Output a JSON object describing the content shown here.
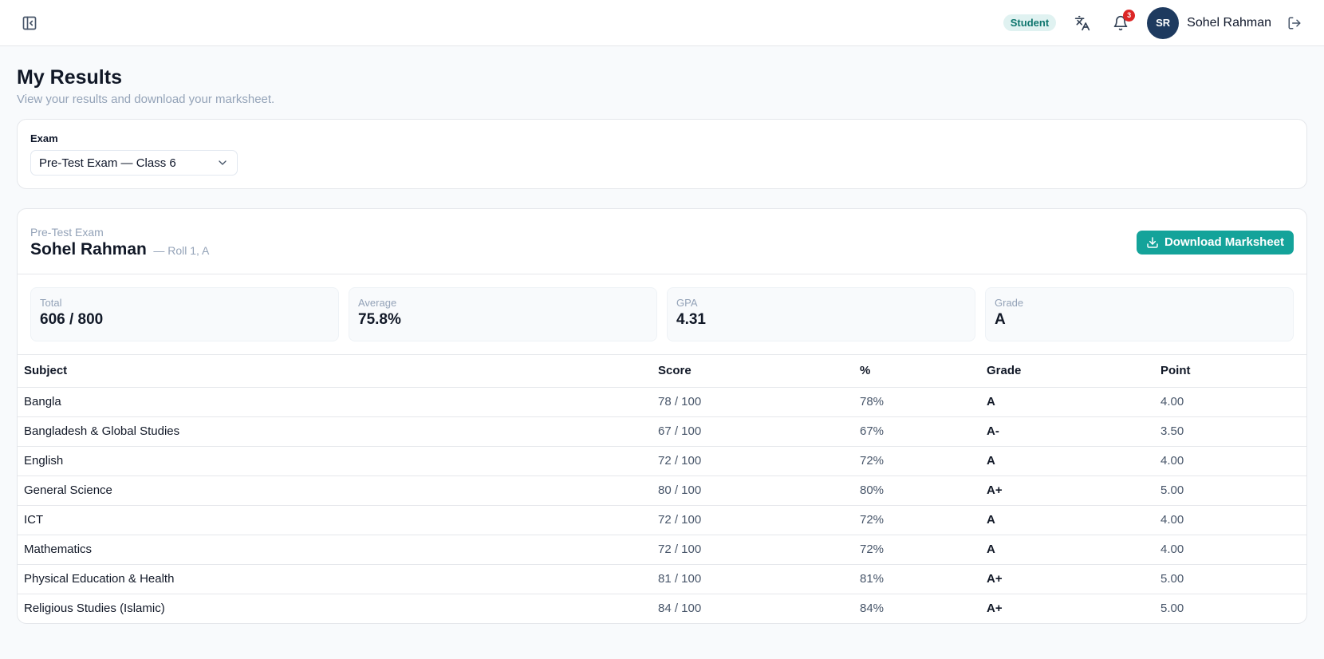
{
  "header": {
    "role_badge": "Student",
    "notification_count": "3",
    "user_initials": "SR",
    "user_name": "Sohel Rahman"
  },
  "page": {
    "title": "My Results",
    "subtitle": "View your results and download your marksheet."
  },
  "filter": {
    "label": "Exam",
    "selected": "Pre-Test Exam — Class 6"
  },
  "result": {
    "exam_name": "Pre-Test Exam",
    "student_name": "Sohel Rahman",
    "roll_info": "— Roll 1, A",
    "download_label": "Download Marksheet",
    "stats": [
      {
        "label": "Total",
        "value": "606 / 800"
      },
      {
        "label": "Average",
        "value": "75.8%"
      },
      {
        "label": "GPA",
        "value": "4.31"
      },
      {
        "label": "Grade",
        "value": "A"
      }
    ],
    "columns": [
      "Subject",
      "Score",
      "%",
      "Grade",
      "Point"
    ],
    "rows": [
      [
        "Bangla",
        "78 / 100",
        "78%",
        "A",
        "4.00"
      ],
      [
        "Bangladesh & Global Studies",
        "67 / 100",
        "67%",
        "A-",
        "3.50"
      ],
      [
        "English",
        "72 / 100",
        "72%",
        "A",
        "4.00"
      ],
      [
        "General Science",
        "80 / 100",
        "80%",
        "A+",
        "5.00"
      ],
      [
        "ICT",
        "72 / 100",
        "72%",
        "A",
        "4.00"
      ],
      [
        "Mathematics",
        "72 / 100",
        "72%",
        "A",
        "4.00"
      ],
      [
        "Physical Education & Health",
        "81 / 100",
        "81%",
        "A+",
        "5.00"
      ],
      [
        "Religious Studies (Islamic)",
        "84 / 100",
        "84%",
        "A+",
        "5.00"
      ]
    ]
  },
  "icons": {
    "sidebar_toggle": "panel-left-close-icon",
    "translate": "languages-icon",
    "notifications": "bell-icon",
    "logout": "log-out-icon",
    "select_chevron": "chevron-down-icon",
    "download": "download-icon"
  }
}
